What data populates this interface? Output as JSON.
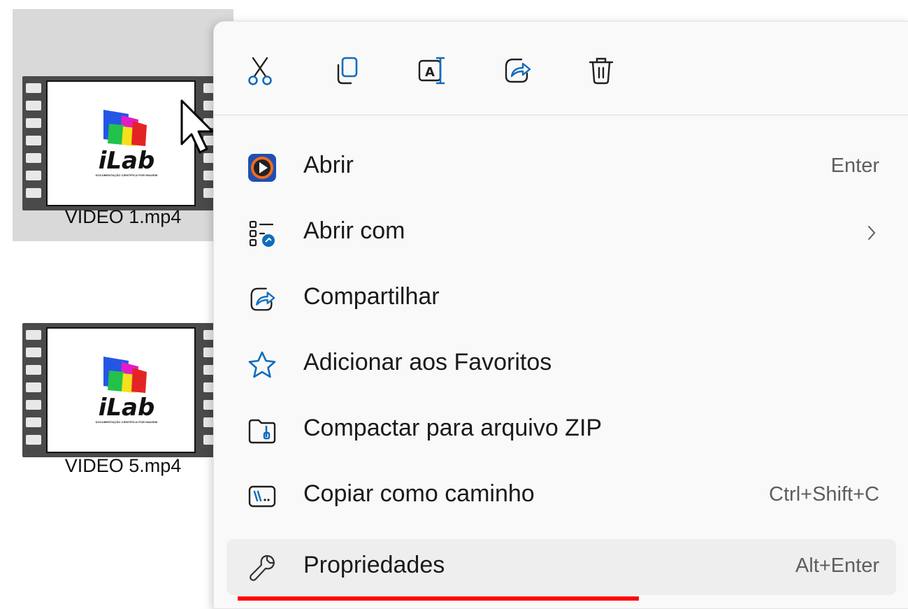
{
  "desktop": {
    "files": [
      {
        "name": "VIDEO 1.mp4",
        "selected": true,
        "thumbnail": {
          "logo_text": "iLab",
          "tagline": "DOCUMENTAÇÃO CIENTÍFICA POR IMAGEM"
        }
      },
      {
        "name": "VIDEO 5.mp4",
        "selected": false,
        "thumbnail": {
          "logo_text": "iLab",
          "tagline": "DOCUMENTAÇÃO CIENTÍFICA POR IMAGEM"
        }
      }
    ]
  },
  "context_menu": {
    "quick_actions": [
      {
        "name": "cut-icon"
      },
      {
        "name": "copy-icon"
      },
      {
        "name": "rename-icon"
      },
      {
        "name": "share-icon"
      },
      {
        "name": "delete-icon"
      }
    ],
    "items": [
      {
        "label": "Abrir",
        "shortcut": "Enter",
        "icon": "media-player-icon"
      },
      {
        "label": "Abrir com",
        "shortcut": "",
        "icon": "open-with-icon",
        "submenu": true
      },
      {
        "label": "Compartilhar",
        "shortcut": "",
        "icon": "share-icon"
      },
      {
        "label": "Adicionar aos Favoritos",
        "shortcut": "",
        "icon": "star-icon"
      },
      {
        "label": "Compactar para arquivo ZIP",
        "shortcut": "",
        "icon": "zip-folder-icon"
      },
      {
        "label": "Copiar como caminho",
        "shortcut": "Ctrl+Shift+C",
        "icon": "copy-path-icon"
      },
      {
        "label": "Propriedades",
        "shortcut": "Alt+Enter",
        "icon": "wrench-icon",
        "highlighted": true
      }
    ]
  },
  "colors": {
    "accent_blue": "#0f6cbd",
    "annotation_red": "#ff0000",
    "menu_background": "#f9f9f9",
    "hover_background": "#eeeeee"
  }
}
